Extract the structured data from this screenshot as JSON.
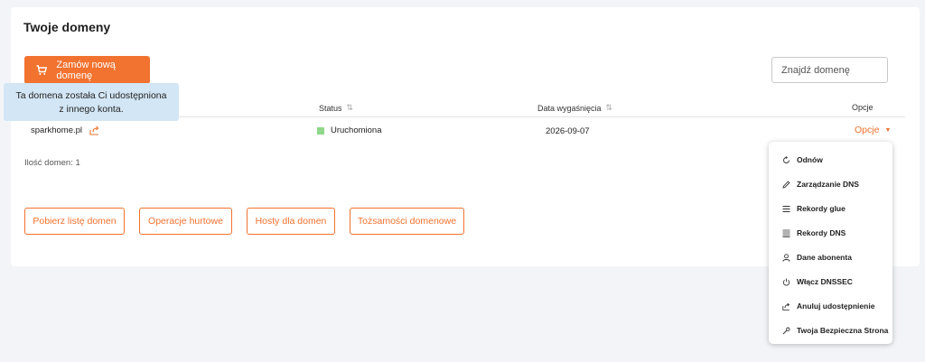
{
  "page": {
    "title": "Twoje domeny"
  },
  "toolbar": {
    "order_label": "Zamów nową domenę",
    "search_placeholder": "Znajdź domenę"
  },
  "tooltip": {
    "text": "Ta domena została Ci udostępniona z innego konta."
  },
  "table": {
    "headers": {
      "status": "Status",
      "expiry": "Data wygaśnięcia",
      "options": "Opcje"
    },
    "rows": [
      {
        "domain": "sparkhome.pl",
        "status": "Uruchomiona",
        "expiry": "2026-09-07",
        "options_label": "Opcje"
      }
    ]
  },
  "summary": {
    "count_text": "Ilość domen: 1"
  },
  "actions": {
    "download": "Pobierz listę domen",
    "bulk": "Operacje hurtowe",
    "hosts": "Hosty dla domen",
    "identities": "Tożsamości domenowe"
  },
  "dropdown": {
    "items": [
      {
        "label": "Odnów",
        "icon": "refresh-icon"
      },
      {
        "label": "Zarządzanie DNS",
        "icon": "pencil-icon"
      },
      {
        "label": "Rekordy glue",
        "icon": "lines-icon"
      },
      {
        "label": "Rekordy DNS",
        "icon": "list-icon"
      },
      {
        "label": "Dane abonenta",
        "icon": "user-icon"
      },
      {
        "label": "Włącz DNSSEC",
        "icon": "power-icon"
      },
      {
        "label": "Anuluj udostępnienie",
        "icon": "share-icon"
      },
      {
        "label": "Twoja Bezpieczna Strona",
        "icon": "wrench-icon"
      }
    ]
  },
  "colors": {
    "accent": "#f2722f",
    "status_ok": "#8fd88a",
    "tooltip_bg": "#d2e6f5"
  }
}
